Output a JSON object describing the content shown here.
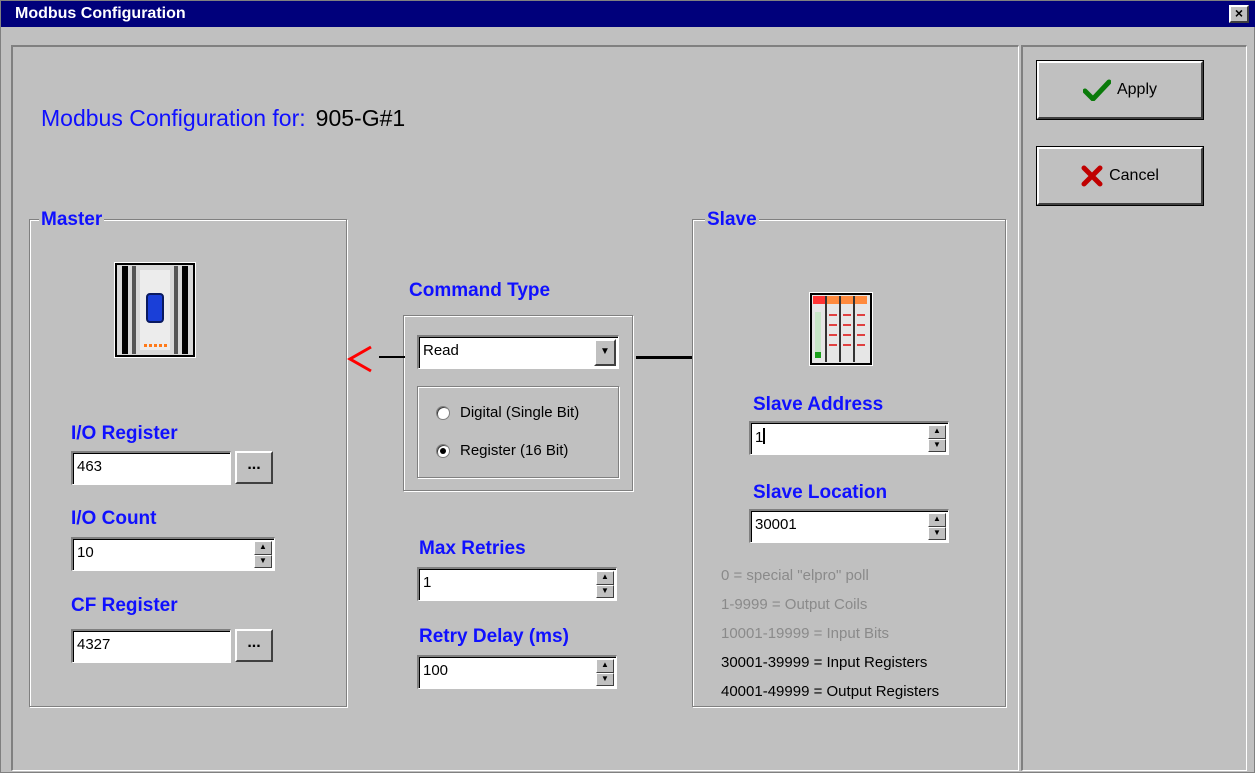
{
  "window": {
    "title": "Modbus Configuration",
    "close_label": "×"
  },
  "heading": {
    "label": "Modbus Configuration for:",
    "device": "905-G#1"
  },
  "buttons": {
    "apply": "Apply",
    "cancel": "Cancel",
    "browse": "..."
  },
  "master": {
    "group_label": "Master",
    "io_register_label": "I/O Register",
    "io_register_value": "463",
    "io_count_label": "I/O Count",
    "io_count_value": "10",
    "cf_register_label": "CF Register",
    "cf_register_value": "4327"
  },
  "command": {
    "label": "Command Type",
    "selected": "Read",
    "options": [
      "Digital (Single Bit)",
      "Register (16 Bit)"
    ],
    "checked_index": 1,
    "direction_glyph": "<"
  },
  "retries": {
    "max_retries_label": "Max Retries",
    "max_retries_value": "1",
    "retry_delay_label": "Retry Delay (ms)",
    "retry_delay_value": "100"
  },
  "slave": {
    "group_label": "Slave",
    "address_label": "Slave Address",
    "address_value": "1",
    "location_label": "Slave Location",
    "location_value": "30001",
    "hints": [
      {
        "text": "0 = special \"elpro\" poll",
        "active": false
      },
      {
        "text": "1-9999 = Output Coils",
        "active": false
      },
      {
        "text": "10001-19999 = Input Bits",
        "active": false
      },
      {
        "text": "30001-39999 = Input Registers",
        "active": true
      },
      {
        "text": "40001-49999 = Output Registers",
        "active": true
      }
    ]
  },
  "colors": {
    "title_bar": "#00007b",
    "label_blue": "#1010ff",
    "face": "#c0c0c0",
    "arrow": "#ff0000"
  },
  "icons": [
    "close-icon",
    "checkmark-icon",
    "x-icon",
    "master-device-icon",
    "slave-rack-icon",
    "spin-up-icon",
    "spin-down-icon",
    "dropdown-arrow-icon"
  ]
}
